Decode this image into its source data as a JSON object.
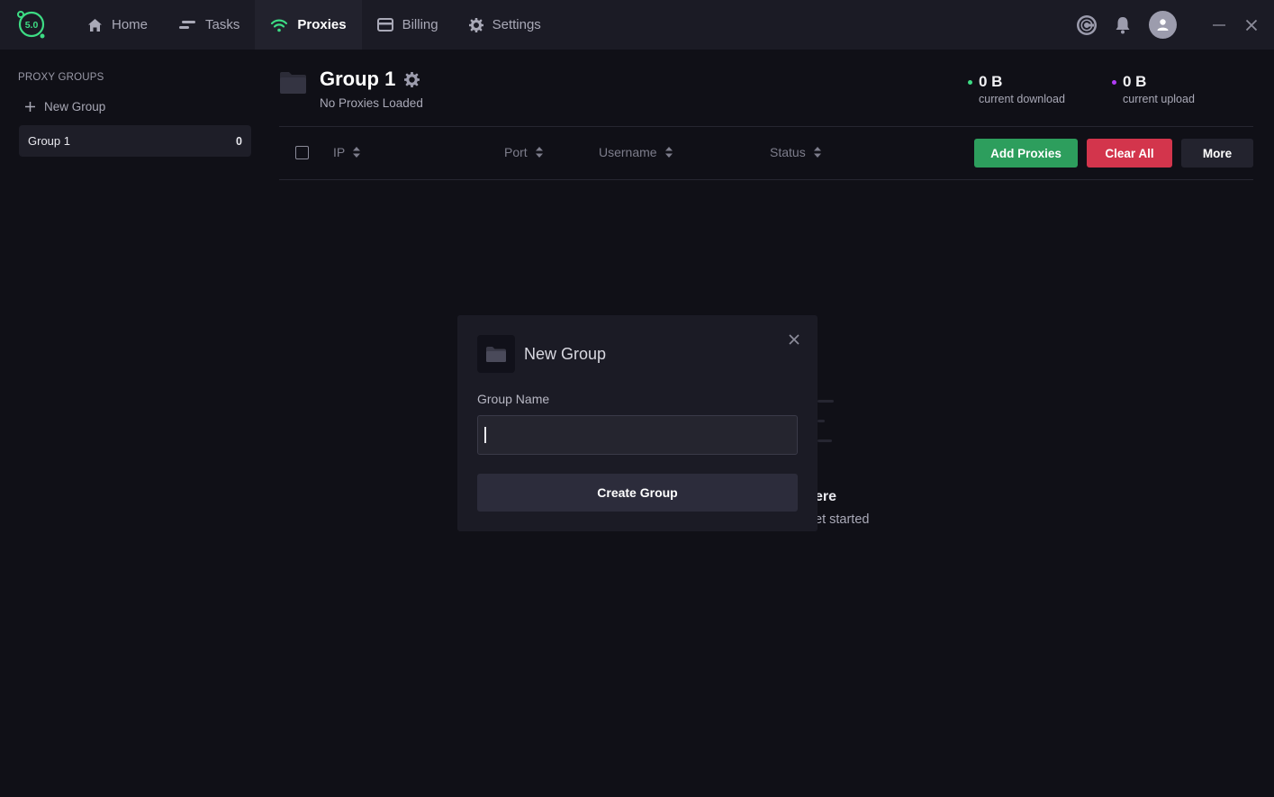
{
  "app": {
    "logo_text": "5.0",
    "accent": "#3ddc84"
  },
  "nav": {
    "items": [
      {
        "label": "Home",
        "icon": "home-icon"
      },
      {
        "label": "Tasks",
        "icon": "tasks-icon"
      },
      {
        "label": "Proxies",
        "icon": "wifi-icon",
        "active": true
      },
      {
        "label": "Billing",
        "icon": "card-icon"
      },
      {
        "label": "Settings",
        "icon": "gear-icon"
      }
    ]
  },
  "sidebar": {
    "title": "PROXY GROUPS",
    "new_group_label": "New Group",
    "groups": [
      {
        "name": "Group 1",
        "count": "0"
      }
    ]
  },
  "header": {
    "group_title": "Group 1",
    "subtitle": "No Proxies Loaded",
    "download": {
      "value": "0 B",
      "label": "current download",
      "dot_color": "#3ddc84"
    },
    "upload": {
      "value": "0 B",
      "label": "current upload",
      "dot_color": "#b13cf5"
    }
  },
  "table": {
    "columns": [
      "IP",
      "Port",
      "Username",
      "Status"
    ],
    "buttons": {
      "add": "Add Proxies",
      "clear": "Clear All",
      "more": "More"
    },
    "colors": {
      "add": "#2d9e5d",
      "clear": "#d3354c"
    }
  },
  "empty_state": {
    "title_visible": "ere",
    "subtitle_visible": "et started"
  },
  "modal": {
    "title": "New Group",
    "field_label": "Group Name",
    "field_value": "",
    "submit_label": "Create Group"
  }
}
